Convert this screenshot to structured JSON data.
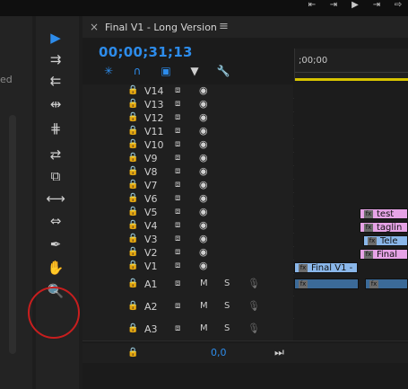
{
  "top_tools": [
    "⇤",
    "⇥",
    "▶",
    "⇥",
    "⇨"
  ],
  "left_panel": {
    "text": "ed"
  },
  "tools": [
    {
      "name": "selection-tool",
      "glyph": "▶",
      "active": true
    },
    {
      "name": "track-select-forward-tool",
      "glyph": "⇉",
      "active": false
    },
    {
      "name": "track-select-backward-tool",
      "glyph": "⇇",
      "active": false
    },
    {
      "name": "ripple-edit-tool",
      "glyph": "⇹",
      "active": false
    },
    {
      "name": "rolling-edit-tool",
      "glyph": "⋕",
      "active": false
    },
    {
      "name": "rate-stretch-tool",
      "glyph": "⇄",
      "active": false
    },
    {
      "name": "razor-tool",
      "glyph": "⧉",
      "active": false
    },
    {
      "name": "slip-tool",
      "glyph": "⟷",
      "active": false
    },
    {
      "name": "slide-tool",
      "glyph": "⇔",
      "active": false
    },
    {
      "name": "pen-tool",
      "glyph": "✒",
      "active": false
    },
    {
      "name": "hand-tool",
      "glyph": "✋",
      "active": false
    },
    {
      "name": "zoom-tool",
      "glyph": "🔍",
      "active": false
    }
  ],
  "sequence": {
    "tab_close": "×",
    "tab_title": "Final V1 - Long Version",
    "tab_menu": "≡",
    "timecode": "00;00;31;13",
    "ruler_label": ";00;00",
    "controls": [
      {
        "name": "snap-icon",
        "glyph": "✳",
        "color": "#2d8ceb"
      },
      {
        "name": "linked-selection-icon",
        "glyph": "∩",
        "color": "#2d8ceb"
      },
      {
        "name": "marker-icon",
        "glyph": "▣",
        "color": "#2d8ceb"
      },
      {
        "name": "add-marker-icon",
        "glyph": "▼",
        "color": "#cfcfcf"
      },
      {
        "name": "wrench-icon",
        "glyph": "🔧",
        "color": "#cfcfcf"
      }
    ]
  },
  "video_tracks": [
    "V14",
    "V13",
    "V12",
    "V11",
    "V10",
    "V9",
    "V8",
    "V7",
    "V6",
    "V5",
    "V4",
    "V3",
    "V2",
    "V1"
  ],
  "audio_tracks": [
    "A1",
    "A2",
    "A3"
  ],
  "track_labels": {
    "mute": "M",
    "solo": "S"
  },
  "clips": {
    "v5": "test",
    "v4": "taglin",
    "v3": "Tele",
    "v2": "Final",
    "v1": "Final V1 -",
    "fx": "fx"
  },
  "bottom": {
    "value": "0,0"
  }
}
